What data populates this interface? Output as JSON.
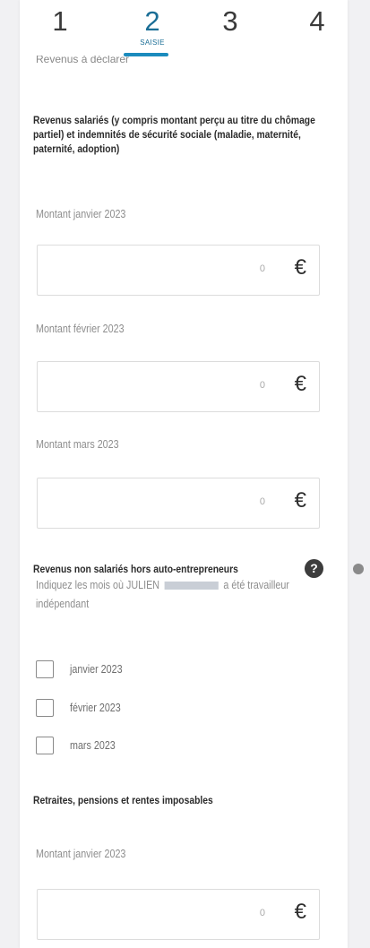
{
  "steps": {
    "items": [
      "1",
      "2",
      "3",
      "4"
    ],
    "active_caption": "SAISIE",
    "cut_heading": "Revenus à déclarer"
  },
  "salaries": {
    "heading": "Revenus salariés (y compris montant perçu au titre du chômage partiel) et indemnités de sécurité sociale (maladie, maternité, paternité, adoption)",
    "fields": [
      {
        "label": "Montant janvier 2023",
        "value": "0",
        "currency": "€"
      },
      {
        "label": "Montant février 2023",
        "value": "0",
        "currency": "€"
      },
      {
        "label": "Montant mars 2023",
        "value": "0",
        "currency": "€"
      }
    ]
  },
  "non_salaries": {
    "heading": "Revenus non salariés hors auto-entrepreneurs",
    "help_icon": "?",
    "hint_before": "Indiquez les mois où JULIEN",
    "hint_after": "a été travailleur indépendant",
    "checkboxes": [
      {
        "label": "janvier 2023",
        "checked": false
      },
      {
        "label": "février 2023",
        "checked": false
      },
      {
        "label": "mars 2023",
        "checked": false
      }
    ]
  },
  "retraites": {
    "heading": "Retraites, pensions et rentes imposables",
    "fields": [
      {
        "label": "Montant janvier 2023",
        "value": "0",
        "currency": "€"
      }
    ]
  },
  "colors": {
    "accent": "#1b8bbd",
    "active_step": "#1b6e96",
    "text": "#2b2b2b",
    "muted": "#8e8e8e"
  }
}
